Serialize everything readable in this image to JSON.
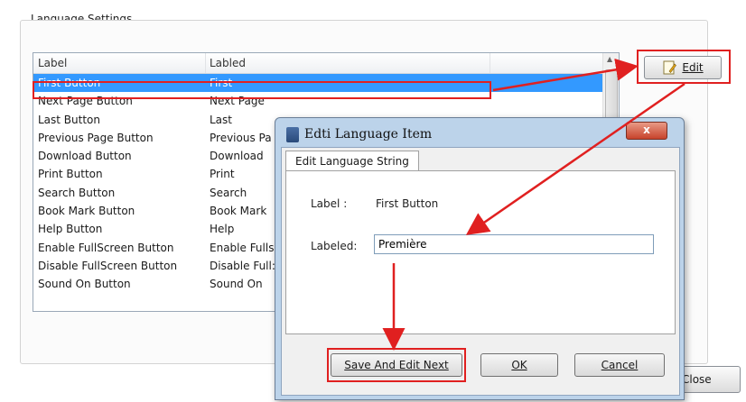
{
  "group_title": "Language Settings",
  "listview": {
    "columns": [
      "Label",
      "Labled"
    ],
    "rows": [
      {
        "label": "First Button",
        "labeled": "First",
        "selected": true
      },
      {
        "label": "Next Page Button",
        "labeled": "Next Page"
      },
      {
        "label": "Last Button",
        "labeled": "Last"
      },
      {
        "label": "Previous Page Button",
        "labeled": "Previous Pa"
      },
      {
        "label": "Download Button",
        "labeled": "Download"
      },
      {
        "label": "Print Button",
        "labeled": "Print"
      },
      {
        "label": "Search Button",
        "labeled": "Search"
      },
      {
        "label": "Book Mark Button",
        "labeled": "Book Mark"
      },
      {
        "label": "Help Button",
        "labeled": "Help"
      },
      {
        "label": "Enable FullScreen Button",
        "labeled": "Enable Fulls"
      },
      {
        "label": "Disable FullScreen Button",
        "labeled": "Disable Full:"
      },
      {
        "label": "Sound On Button",
        "labeled": "Sound On"
      }
    ]
  },
  "edit_button": "Edit",
  "close_button": "Close",
  "dialog": {
    "title": "Edti Language Item",
    "tab": "Edit Language String",
    "label_caption": "Label :",
    "label_value": "First Button",
    "labeled_caption": "Labeled:",
    "labeled_value": "Première",
    "save_button": "Save And Edit Next",
    "ok_button": "OK",
    "cancel_button": "Cancel",
    "close_icon": "x"
  },
  "colors": {
    "annotation": "#e02020",
    "selection": "#3399ff"
  }
}
